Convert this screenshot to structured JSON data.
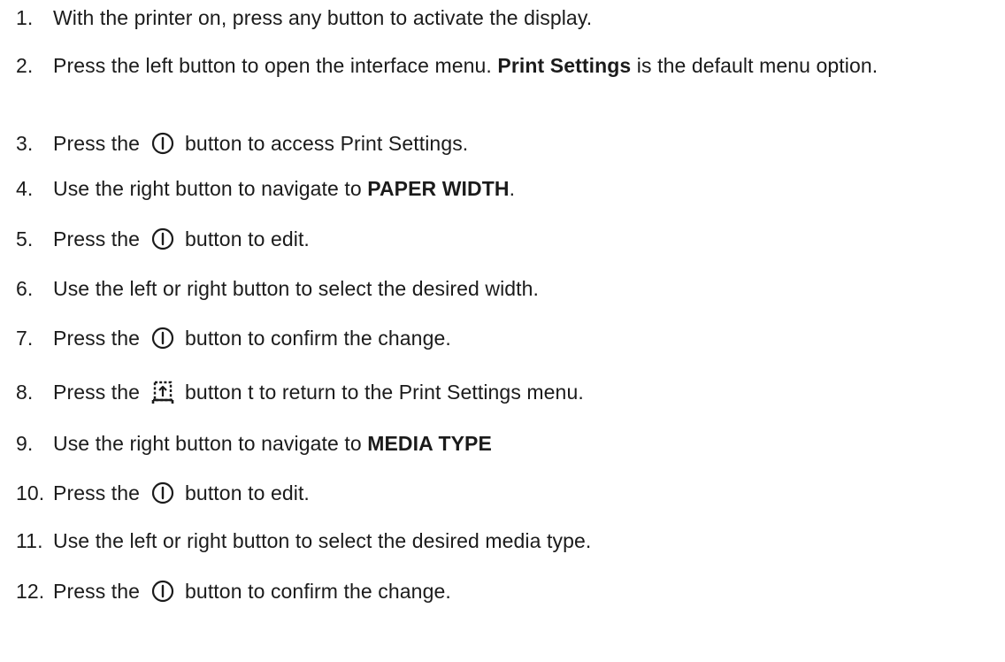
{
  "steps": [
    {
      "num": "1.",
      "parts": [
        {
          "text": "With the printer on, press any button to activate the display."
        }
      ]
    },
    {
      "num": "2.",
      "parts": [
        {
          "text": "Press the left button to open the interface menu. "
        },
        {
          "text": "Print Settings",
          "bold": true
        },
        {
          "text": " is the default menu option."
        }
      ]
    },
    {
      "num": "3.",
      "parts": [
        {
          "text": "Press the "
        },
        {
          "icon": "power-icon"
        },
        {
          "text": " button to access Print Settings."
        }
      ]
    },
    {
      "num": "4.",
      "parts": [
        {
          "text": "Use the right button to navigate to "
        },
        {
          "text": "PAPER WIDTH",
          "bold": true
        },
        {
          "text": "."
        }
      ]
    },
    {
      "num": "5.",
      "parts": [
        {
          "text": "Press the "
        },
        {
          "icon": "power-icon"
        },
        {
          "text": " button to edit."
        }
      ]
    },
    {
      "num": "6.",
      "parts": [
        {
          "text": "Use the left or right button to select the desired width."
        }
      ]
    },
    {
      "num": "7.",
      "parts": [
        {
          "text": "Press the "
        },
        {
          "icon": "power-icon"
        },
        {
          "text": " button to confirm the change."
        }
      ]
    },
    {
      "num": "8.",
      "parts": [
        {
          "text": "Press the "
        },
        {
          "icon": "feed-icon"
        },
        {
          "text": " button t to return to the Print Settings menu."
        }
      ]
    },
    {
      "num": "9.",
      "parts": [
        {
          "text": "Use the right button to navigate to "
        },
        {
          "text": "MEDIA TYPE",
          "bold": true
        }
      ]
    },
    {
      "num": "10.",
      "parts": [
        {
          "text": "Press the "
        },
        {
          "icon": "power-icon"
        },
        {
          "text": " button to edit."
        }
      ]
    },
    {
      "num": "11.",
      "parts": [
        {
          "text": "Use the left or right button to select the desired media type."
        }
      ]
    },
    {
      "num": "12.",
      "parts": [
        {
          "text": "Press the "
        },
        {
          "icon": "power-icon"
        },
        {
          "text": " button to confirm the change."
        }
      ]
    }
  ]
}
